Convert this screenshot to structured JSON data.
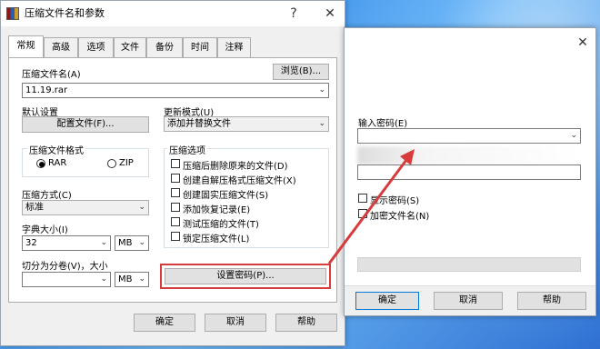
{
  "main_dialog": {
    "title": "压缩文件名和参数",
    "help_glyph": "?",
    "close_glyph": "✕",
    "tabs": [
      "常规",
      "高级",
      "选项",
      "文件",
      "备份",
      "时间",
      "注释"
    ],
    "archive_name_label": "压缩文件名(A)",
    "browse_label": "浏览(B)...",
    "archive_name_value": "11.19.rar",
    "default_settings_label": "默认设置",
    "profiles_label": "配置文件(F)...",
    "update_mode_label": "更新模式(U)",
    "update_mode_value": "添加并替换文件",
    "format_group_title": "压缩文件格式",
    "format_rar": "RAR",
    "format_zip": "ZIP",
    "options_group_title": "压缩选项",
    "options": [
      "压缩后删除原来的文件(D)",
      "创建自解压格式压缩文件(X)",
      "创建固实压缩文件(S)",
      "添加恢复记录(E)",
      "测试压缩的文件(T)",
      "锁定压缩文件(L)"
    ],
    "method_label": "压缩方式(C)",
    "method_value": "标准",
    "dict_label": "字典大小(I)",
    "dict_value": "32",
    "dict_unit": "MB",
    "split_label": "切分为分卷(V)，大小",
    "split_value": "",
    "split_unit": "MB",
    "set_password_label": "设置密码(P)...",
    "ok_label": "确定",
    "cancel_label": "取消",
    "help_label": "帮助"
  },
  "password_dialog": {
    "close_glyph": "✕",
    "enter_password_label": "输入密码(E)",
    "show_password_label": "显示密码(S)",
    "encrypt_names_label": "加密文件名(N)",
    "ok_label": "确定",
    "cancel_label": "取消",
    "help_label": "帮助"
  },
  "colors": {
    "highlight_red": "#d83b3b",
    "default_button_border": "#0078d7"
  }
}
